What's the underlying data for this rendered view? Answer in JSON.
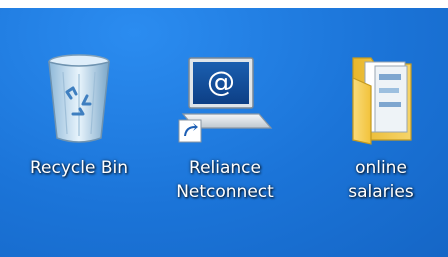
{
  "desktop": {
    "icons": [
      {
        "name": "recycle-bin",
        "label_lines": [
          "Recycle Bin"
        ],
        "icon": "recycle-bin-icon"
      },
      {
        "name": "reliance-netconnect",
        "label_lines": [
          "Reliance",
          "Netconnect"
        ],
        "icon": "network-shortcut-icon"
      },
      {
        "name": "online-salaries",
        "label_lines": [
          "online",
          "salaries"
        ],
        "icon": "folder-icon"
      }
    ]
  },
  "colors": {
    "desktop_background": "#1e7be0",
    "label_text": "#ffffff",
    "folder_yellow": "#f2c23a",
    "bin_glass": "#c9e2f5"
  }
}
